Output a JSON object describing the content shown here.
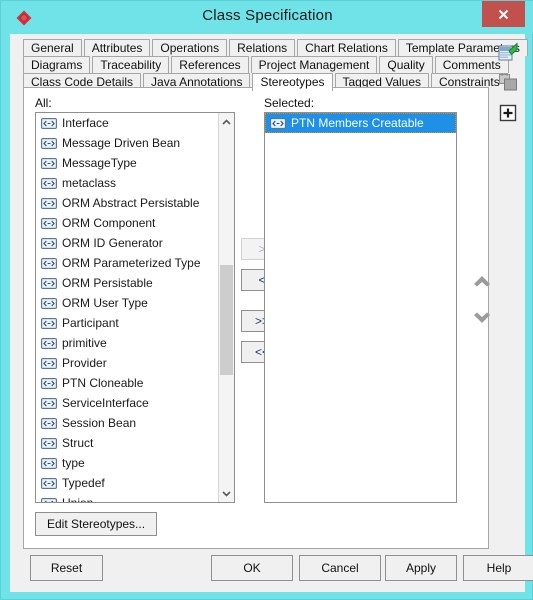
{
  "window": {
    "title": "Class Specification",
    "app_icon": "diamond-icon",
    "close_label": "×"
  },
  "tabs": {
    "rows": [
      [
        {
          "label": "General",
          "active": false
        },
        {
          "label": "Attributes",
          "active": false
        },
        {
          "label": "Operations",
          "active": false
        },
        {
          "label": "Relations",
          "active": false
        },
        {
          "label": "Chart Relations",
          "active": false
        },
        {
          "label": "Template Parameters",
          "active": false
        }
      ],
      [
        {
          "label": "Diagrams",
          "active": false
        },
        {
          "label": "Traceability",
          "active": false
        },
        {
          "label": "References",
          "active": false
        },
        {
          "label": "Project Management",
          "active": false
        },
        {
          "label": "Quality",
          "active": false
        },
        {
          "label": "Comments",
          "active": false
        }
      ],
      [
        {
          "label": "Class Code Details",
          "active": false
        },
        {
          "label": "Java Annotations",
          "active": false
        },
        {
          "label": "Stereotypes",
          "active": true
        },
        {
          "label": "Tagged Values",
          "active": false
        },
        {
          "label": "Constraints",
          "active": false
        }
      ]
    ]
  },
  "page": {
    "all_caption": "All:",
    "selected_caption": "Selected:",
    "all_items": [
      "Interface",
      "Message Driven Bean",
      "MessageType",
      "metaclass",
      "ORM Abstract Persistable",
      "ORM Component",
      "ORM ID Generator",
      "ORM Parameterized Type",
      "ORM Persistable",
      "ORM User Type",
      "Participant",
      "primitive",
      "Provider",
      "PTN Cloneable",
      "ServiceInterface",
      "Session Bean",
      "Struct",
      "type",
      "Typedef",
      "Union"
    ],
    "selected_items": [
      {
        "label": "PTN Members Creatable",
        "selected": true
      }
    ],
    "transfer_buttons": [
      {
        "label": ">",
        "name": "add-button",
        "disabled": true
      },
      {
        "label": "<",
        "name": "remove-button",
        "disabled": false
      },
      {
        "label": ">>",
        "name": "add-all-button",
        "disabled": false
      },
      {
        "label": "<<",
        "name": "remove-all-button",
        "disabled": false
      }
    ],
    "order_buttons": [
      {
        "name": "move-up-button",
        "icon": "chevron-up-icon"
      },
      {
        "name": "move-down-button",
        "icon": "chevron-down-icon"
      }
    ],
    "edit_stereotypes_label": "Edit Stereotypes..."
  },
  "side_tools": [
    {
      "name": "new-item-icon",
      "title": "new"
    },
    {
      "name": "duplicate-icon",
      "title": "duplicate"
    },
    {
      "name": "add-box-icon",
      "title": "add"
    }
  ],
  "buttons": {
    "reset": "Reset",
    "ok": "OK",
    "cancel": "Cancel",
    "apply": "Apply",
    "help": "Help"
  },
  "colors": {
    "title_bar": "#6fe3e8",
    "close_button": "#c2504c",
    "selection": "#1e90e8",
    "focus_outline": "#e08a12"
  },
  "scrollbar": {
    "thumb_top_pct": 38,
    "thumb_height_pct": 31
  }
}
